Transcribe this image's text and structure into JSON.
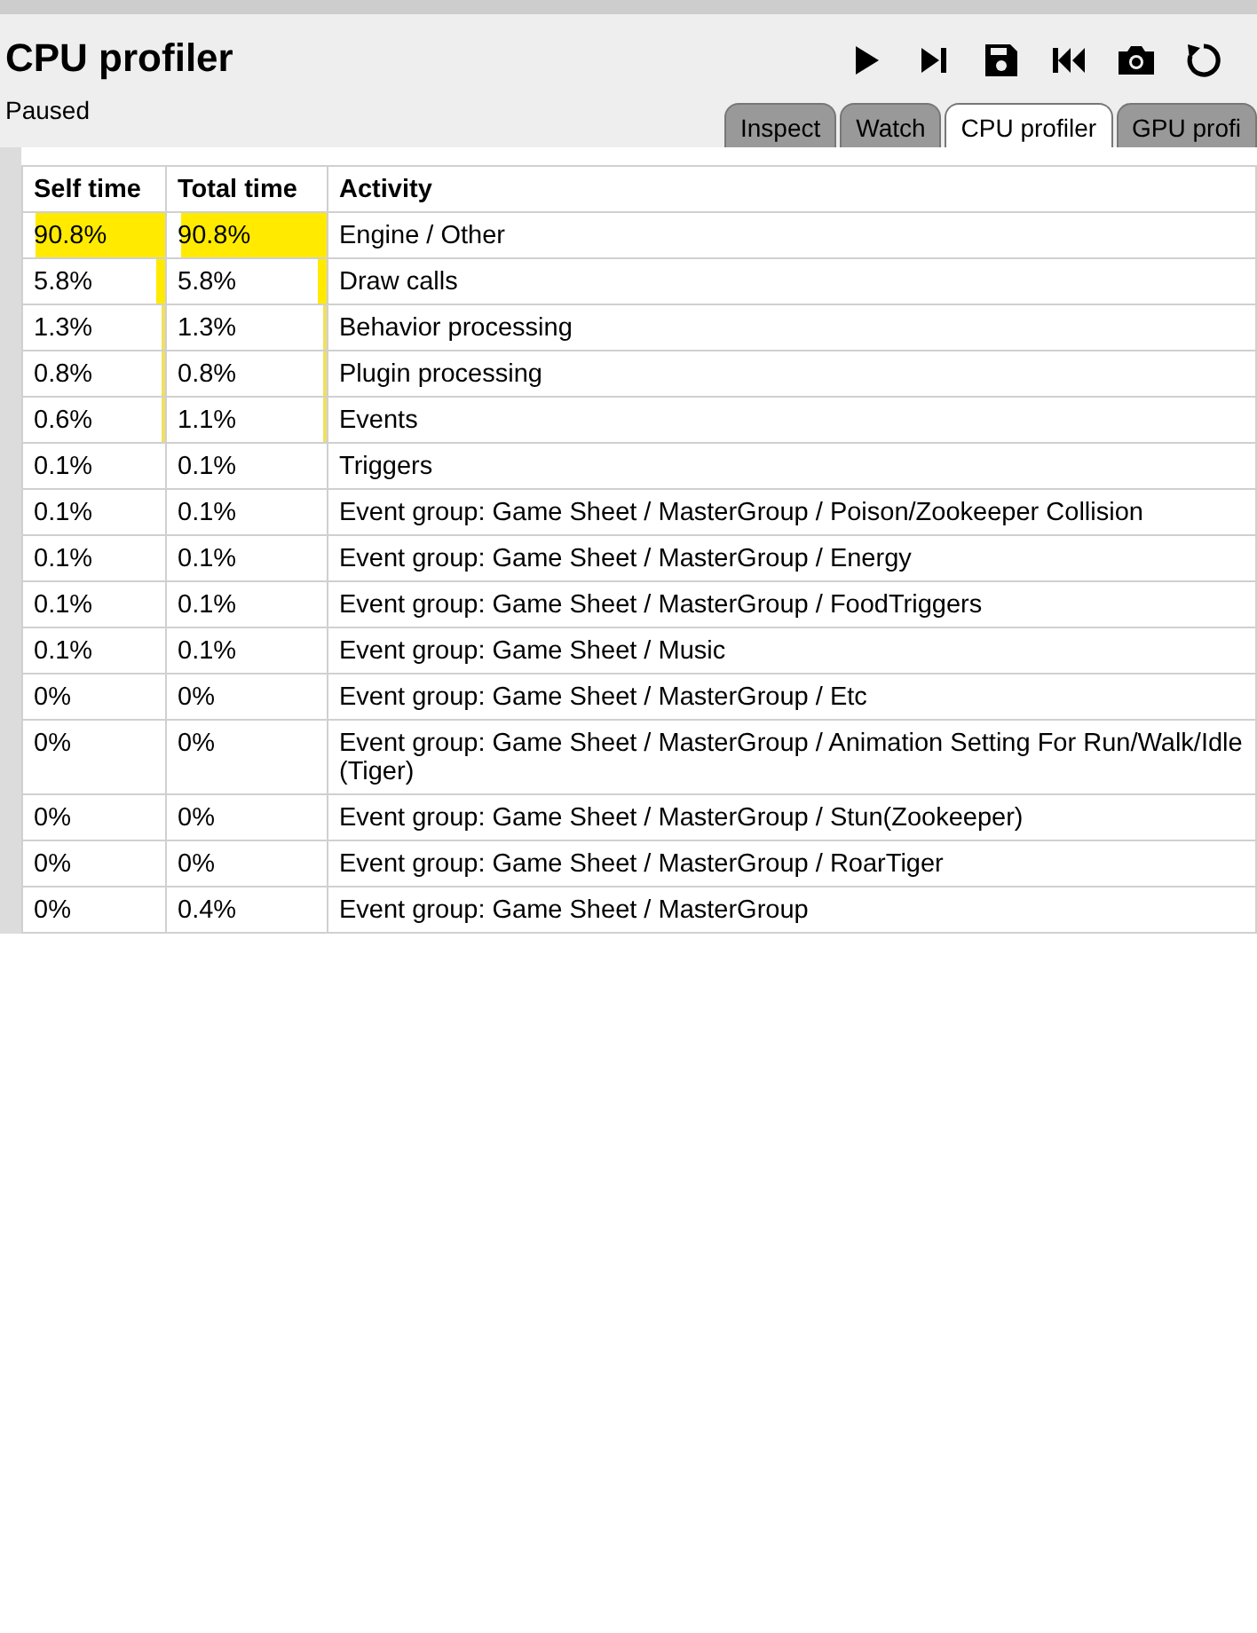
{
  "header": {
    "title": "CPU profiler",
    "status": "Paused"
  },
  "toolbar": [
    {
      "kind": "play"
    },
    {
      "kind": "step"
    },
    {
      "kind": "save"
    },
    {
      "kind": "restart"
    },
    {
      "kind": "screenshot"
    },
    {
      "kind": "reload"
    }
  ],
  "tabs": [
    {
      "label": "Inspect",
      "selected": false
    },
    {
      "label": "Watch",
      "selected": false
    },
    {
      "label": "CPU profiler",
      "selected": true
    },
    {
      "label": "GPU profi",
      "selected": false
    }
  ],
  "table": {
    "columns": [
      "Self time",
      "Total time",
      "Activity"
    ],
    "rows": [
      {
        "self": "90.8%",
        "total": "90.8%",
        "activity": "Engine / Other",
        "self_bar": {
          "level": 0.908
        },
        "total_bar": {
          "level": 0.908
        }
      },
      {
        "self": "5.8%",
        "total": "5.8%",
        "activity": "Draw calls",
        "self_bar": {
          "level": 0.058
        },
        "total_bar": {
          "level": 0.058
        }
      },
      {
        "self": "1.3%",
        "total": "1.3%",
        "activity": "Behavior processing",
        "self_bar": {
          "level": 0.013
        },
        "total_bar": {
          "level": 0.013
        }
      },
      {
        "self": "0.8%",
        "total": "0.8%",
        "activity": "Plugin processing",
        "self_bar": {
          "level": 0.008
        },
        "total_bar": {
          "level": 0.008
        }
      },
      {
        "self": "0.6%",
        "total": "1.1%",
        "activity": "Events",
        "self_bar": {
          "level": 0.006
        },
        "total_bar": {
          "level": 0.011
        }
      },
      {
        "self": "0.1%",
        "total": "0.1%",
        "activity": "Triggers"
      },
      {
        "self": "0.1%",
        "total": "0.1%",
        "activity": "Event group: Game Sheet / MasterGroup / Poison/Zookeeper Collision"
      },
      {
        "self": "0.1%",
        "total": "0.1%",
        "activity": "Event group: Game Sheet / MasterGroup / Energy"
      },
      {
        "self": "0.1%",
        "total": "0.1%",
        "activity": "Event group: Game Sheet / MasterGroup / FoodTriggers"
      },
      {
        "self": "0.1%",
        "total": "0.1%",
        "activity": "Event group: Game Sheet / Music"
      },
      {
        "self": "0%",
        "total": "0%",
        "activity": "Event group: Game Sheet / MasterGroup / Etc"
      },
      {
        "self": "0%",
        "total": "0%",
        "activity": "Event group: Game Sheet / MasterGroup / Animation Setting For Run/Walk/Idle (Tiger)"
      },
      {
        "self": "0%",
        "total": "0%",
        "activity": "Event group: Game Sheet / MasterGroup / Stun(Zookeeper)"
      },
      {
        "self": "0%",
        "total": "0%",
        "activity": "Event group: Game Sheet / MasterGroup / RoarTiger"
      },
      {
        "self": "0%",
        "total": "0.4%",
        "activity": "Event group: Game Sheet / MasterGroup"
      }
    ]
  }
}
